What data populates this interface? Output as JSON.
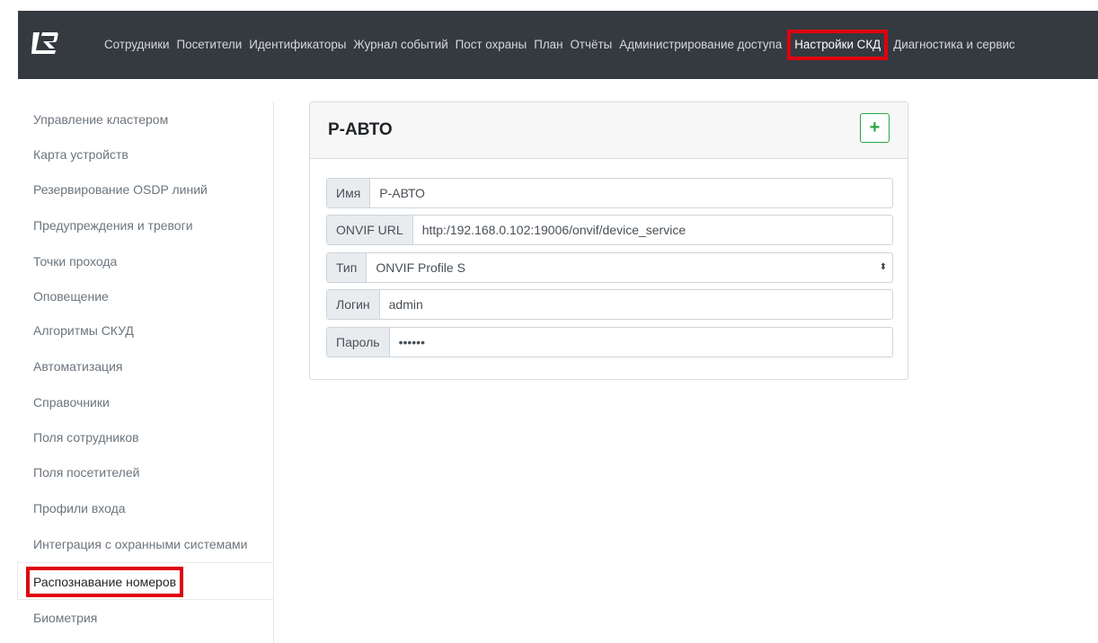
{
  "navbar": {
    "logo": "logo-icon",
    "items": [
      {
        "label": "Сотрудники"
      },
      {
        "label": "Посетители"
      },
      {
        "label": "Идентификаторы"
      },
      {
        "label": "Журнал событий"
      },
      {
        "label": "Пост охраны"
      },
      {
        "label": "План"
      },
      {
        "label": "Отчёты"
      },
      {
        "label": "Администрирование доступа"
      },
      {
        "label": "Настройки СКД"
      },
      {
        "label": "Диагностика и сервис"
      }
    ],
    "active_index": 8,
    "highlight_color": "#e0000f"
  },
  "sidebar": {
    "items": [
      {
        "label": "Управление кластером"
      },
      {
        "label": "Карта устройств"
      },
      {
        "label": "Резервирование OSDP линий"
      },
      {
        "label": "Предупреждения и тревоги"
      },
      {
        "label": "Точки прохода"
      },
      {
        "label": "Оповещение"
      },
      {
        "label": "Алгоритмы СКУД"
      },
      {
        "label": "Автоматизация"
      },
      {
        "label": "Справочники"
      },
      {
        "label": "Поля сотрудников"
      },
      {
        "label": "Поля посетителей"
      },
      {
        "label": "Профили входа"
      },
      {
        "label": "Интеграция с охранными системами"
      },
      {
        "label": "Распознавание номеров"
      },
      {
        "label": "Биометрия"
      }
    ],
    "active_index": 13
  },
  "card": {
    "title": "Р-АВТО",
    "add_button": {
      "label": "+",
      "icon": "plus-icon",
      "color": "#28a745"
    },
    "fields": {
      "name": {
        "label": "Имя",
        "value": "Р-АВТО"
      },
      "onvif_url": {
        "label": "ONVIF URL",
        "value": "http:/192.168.0.102:19006/onvif/device_service"
      },
      "type": {
        "label": "Тип",
        "value": "ONVIF Profile S"
      },
      "login": {
        "label": "Логин",
        "value": "admin"
      },
      "password": {
        "label": "Пароль",
        "value": "••••••"
      }
    }
  }
}
